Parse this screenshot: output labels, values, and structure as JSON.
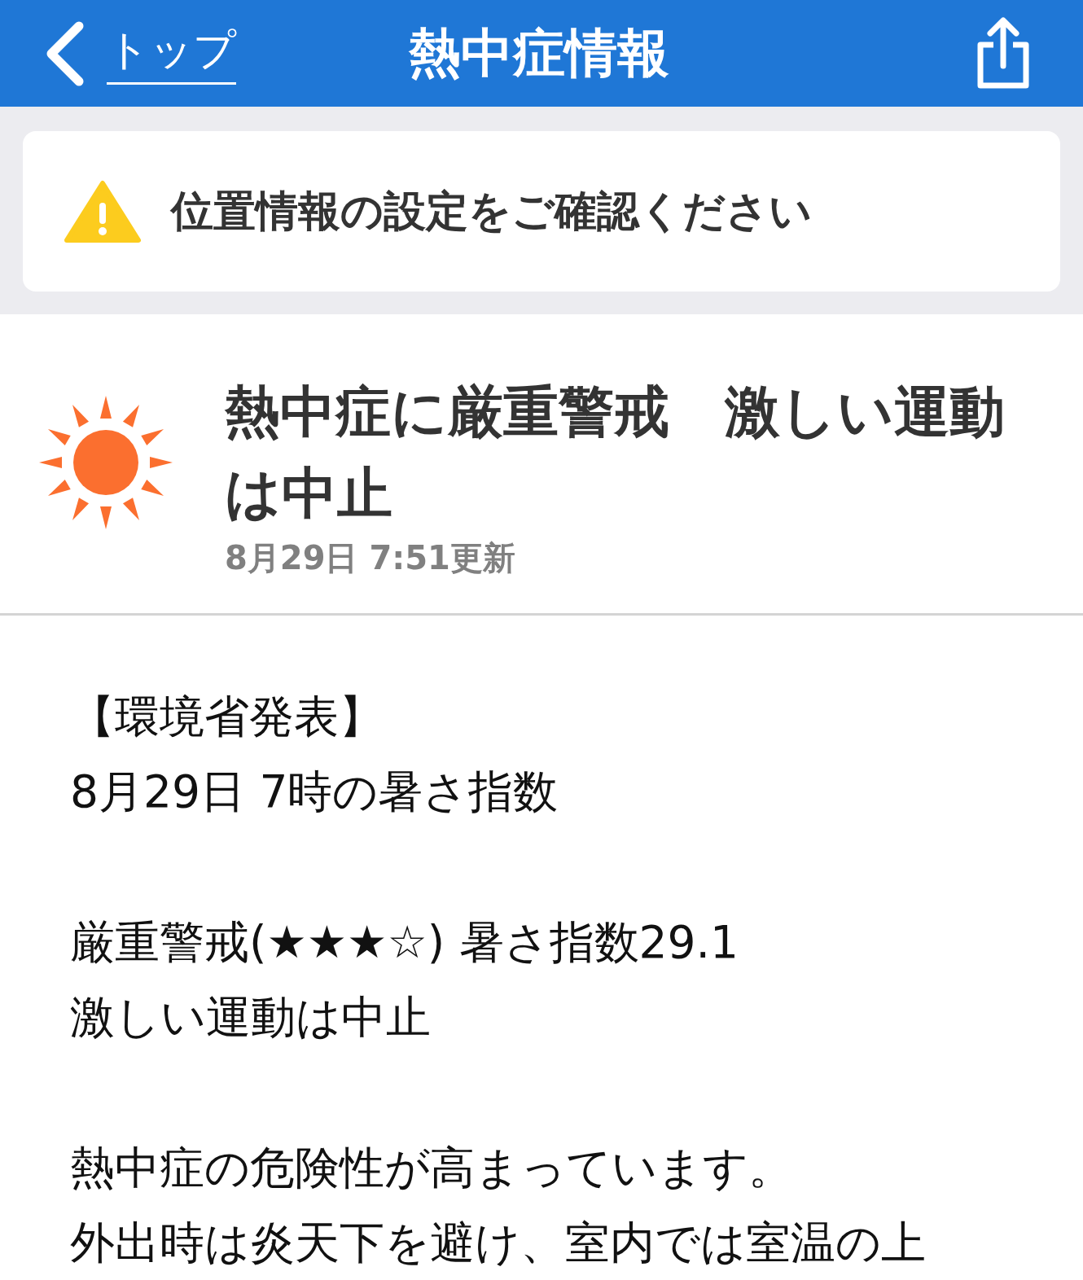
{
  "header": {
    "back_label": "トップ",
    "title": "熱中症情報"
  },
  "location_notice": {
    "text": "位置情報の設定をご確認ください"
  },
  "alert": {
    "headline": "熱中症に厳重警戒　激しい運動は中止",
    "updated": "8月29日 7:51更新"
  },
  "body": {
    "paragraphs": [
      [
        "【環境省発表】",
        "8月29日 7時の暑さ指数"
      ],
      [
        "厳重警戒(★★★☆) 暑さ指数29.1",
        "激しい運動は中止"
      ],
      [
        "熱中症の危険性が高まっています。",
        "外出時は炎天下を避け、室内では室温の上"
      ]
    ]
  }
}
